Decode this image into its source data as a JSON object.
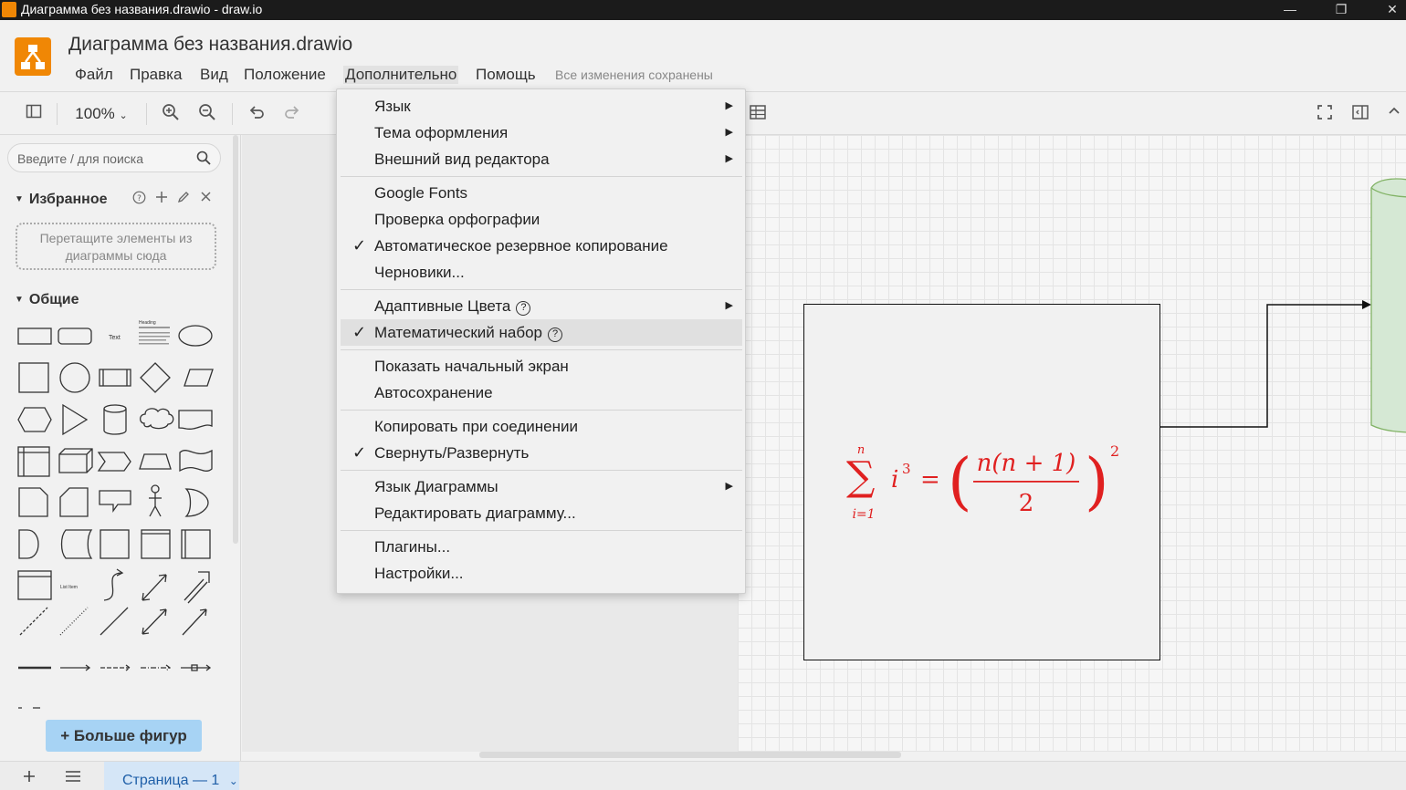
{
  "window": {
    "title": "Диаграмма без названия.drawio - draw.io",
    "minimize": "—",
    "maximize": "❐",
    "close": "✕"
  },
  "header": {
    "doc_title": "Диаграмма без названия.drawio",
    "menu": [
      "Файл",
      "Правка",
      "Вид",
      "Положение",
      "Дополнительно",
      "Помощь"
    ],
    "save_status": "Все изменения сохранены"
  },
  "toolbar": {
    "zoom": "100%"
  },
  "sidebar": {
    "search_placeholder": "Введите / для поиска",
    "favorites_title": "Избранное",
    "favorites_drop_text": "Перетащите элементы из диаграммы сюда",
    "general_title": "Общие",
    "text_shape_label": "Text",
    "heading_shape_label": "Heading",
    "list_item_label": "List Item",
    "more_shapes": "Больше фигур"
  },
  "dropdown": {
    "groups": [
      [
        {
          "label": "Язык",
          "submenu": true
        },
        {
          "label": "Тема оформления",
          "submenu": true
        },
        {
          "label": "Внешний вид редактора",
          "submenu": true
        }
      ],
      [
        {
          "label": "Google Fonts"
        },
        {
          "label": "Проверка орфографии"
        },
        {
          "label": "Автоматическое резервное копирование",
          "checked": true
        },
        {
          "label": "Черновики..."
        }
      ],
      [
        {
          "label": "Адаптивные Цвета",
          "help": true,
          "submenu": true
        },
        {
          "label": "Математический набор",
          "help": true,
          "checked": true,
          "hover": true
        }
      ],
      [
        {
          "label": "Показать начальный экран"
        },
        {
          "label": "Автосохранение"
        }
      ],
      [
        {
          "label": "Копировать при соединении"
        },
        {
          "label": "Свернуть/Развернуть",
          "checked": true
        }
      ],
      [
        {
          "label": "Язык Диаграммы",
          "submenu": true
        },
        {
          "label": "Редактировать диаграмму..."
        }
      ],
      [
        {
          "label": "Плагины..."
        },
        {
          "label": "Настройки..."
        }
      ]
    ]
  },
  "canvas": {
    "formula": {
      "sum_upper": "n",
      "sum_lower": "i=1",
      "term": "i",
      "term_exp": "3",
      "equals": "=",
      "numerator": "n(n + 1)",
      "denominator": "2",
      "outer_exp": "2"
    },
    "colors": {
      "formula": "#e02020",
      "cylinder_fill": "#d5e8d4",
      "cylinder_stroke": "#82b366"
    }
  },
  "bottombar": {
    "page_tab": "Страница — 1"
  },
  "colors": {
    "brand": "#f08705",
    "more_shapes_bg": "#a7d3f4",
    "page_tab_text": "#1f5fa8"
  }
}
